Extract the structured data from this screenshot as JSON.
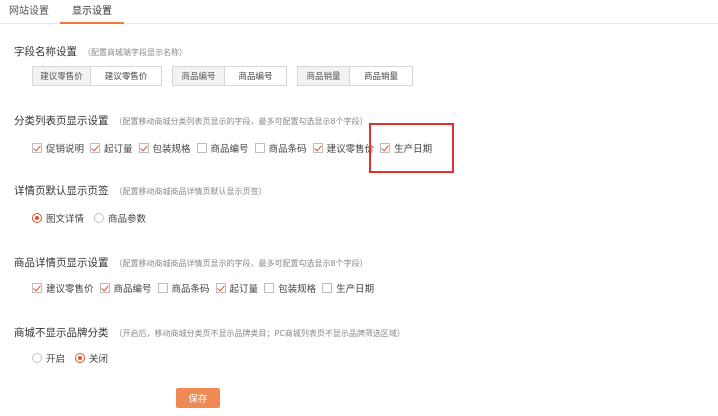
{
  "tabs": [
    {
      "label": "网站设置",
      "active": false
    },
    {
      "label": "显示设置",
      "active": true
    }
  ],
  "field_names": {
    "title": "字段名称设置",
    "hint": "（配置商城端字段显示名称）",
    "pairs": [
      {
        "label": "建议零售价",
        "value": "建议零售价"
      },
      {
        "label": "商品编号",
        "value": "商品编号"
      },
      {
        "label": "商品销量",
        "value": "商品销量"
      }
    ]
  },
  "category_list": {
    "title": "分类列表页显示设置",
    "hint": "（配置移动商城分类列表页显示的字段，最多可配置勾选显示8个字段）",
    "options": [
      {
        "label": "促销说明",
        "checked": true
      },
      {
        "label": "起订量",
        "checked": true
      },
      {
        "label": "包装规格",
        "checked": true
      },
      {
        "label": "商品编号",
        "checked": false
      },
      {
        "label": "商品条码",
        "checked": false
      },
      {
        "label": "建议零售价",
        "checked": true
      },
      {
        "label": "生产日期",
        "checked": true
      }
    ]
  },
  "detail_tab": {
    "title": "详情页默认显示页签",
    "hint": "（配置移动商城商品详情页默认显示页签）",
    "options": [
      {
        "label": "图文详情",
        "selected": true
      },
      {
        "label": "商品参数",
        "selected": false
      }
    ]
  },
  "product_detail": {
    "title": "商品详情页显示设置",
    "hint": "（配置移动商城商品详情页显示的字段，最多可配置勾选显示8个字段）",
    "options": [
      {
        "label": "建议零售价",
        "checked": true
      },
      {
        "label": "商品编号",
        "checked": true
      },
      {
        "label": "商品条码",
        "checked": false
      },
      {
        "label": "起订量",
        "checked": true
      },
      {
        "label": "包装规格",
        "checked": false
      },
      {
        "label": "生产日期",
        "checked": false
      }
    ]
  },
  "brand_category": {
    "title": "商城不显示品牌分类",
    "hint": "（开启后，移动商城分类页不显示品牌类目；PC商城列表页不显示品牌筛选区域）",
    "options": [
      {
        "label": "开启",
        "selected": false
      },
      {
        "label": "关闭",
        "selected": true
      }
    ]
  },
  "save_label": "保存",
  "colors": {
    "accent": "#e0502a",
    "button": "#f08a55",
    "highlight": "#e63030"
  }
}
